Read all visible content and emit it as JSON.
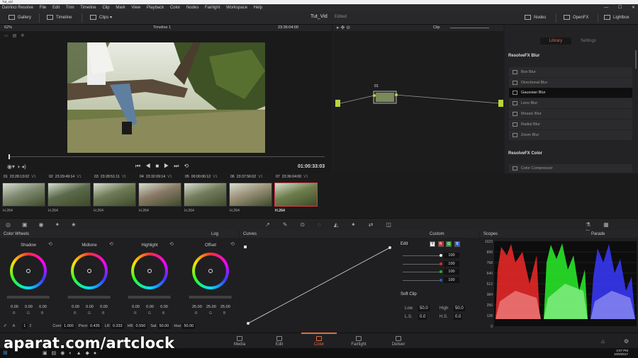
{
  "window": {
    "title": "Tut_vid",
    "app": "DaVinci Resolve",
    "project": "Tut_Vid",
    "status": "Edited"
  },
  "menu": [
    "DaVinci Resolve",
    "File",
    "Edit",
    "Trim",
    "Timeline",
    "Clip",
    "Mark",
    "View",
    "Playback",
    "Color",
    "Nodes",
    "Fairlight",
    "Workspace",
    "Help"
  ],
  "toolbar": {
    "gallery": "Gallery",
    "timeline": "Timeline",
    "clips": "Clips",
    "nodes": "Nodes",
    "openfx": "OpenFX",
    "lightbox": "Lightbox"
  },
  "viewer": {
    "zoom": "62%",
    "timeline_name": "Timeline 1",
    "timecode": "23:36:04:00",
    "duration": "01:00:33:03"
  },
  "nodegraph": {
    "mode": "Clip",
    "node_label": "01"
  },
  "library": {
    "tab_library": "Library",
    "tab_settings": "Settings",
    "section_blur": "ResolveFX Blur",
    "blur_items": [
      "Box Blur",
      "Directional Blur",
      "Gaussian Blur",
      "Lens Blur",
      "Mosaic Blur",
      "Radial Blur",
      "Zoom Blur"
    ],
    "selected": "Gaussian Blur",
    "section_color": "ResolveFX Color",
    "color_items": [
      "Color Compressor"
    ]
  },
  "clips": [
    {
      "num": "01",
      "tc": "23:28:13:02",
      "track": "V1",
      "codec": "H.264"
    },
    {
      "num": "02",
      "tc": "23:29:49:14",
      "track": "V1",
      "codec": "H.264"
    },
    {
      "num": "03",
      "tc": "23:28:51:11",
      "track": "V1",
      "codec": "H.264"
    },
    {
      "num": "04",
      "tc": "23:32:09:14",
      "track": "V1",
      "codec": "H.264"
    },
    {
      "num": "05",
      "tc": "00:00:06:12",
      "track": "V1",
      "codec": "H.264"
    },
    {
      "num": "06",
      "tc": "23:37:56:02",
      "track": "V1",
      "codec": "H.264"
    },
    {
      "num": "07",
      "tc": "23:36:04:00",
      "track": "V1",
      "codec": "H.264"
    }
  ],
  "colorwheels": {
    "title": "Color Wheels",
    "mode": "Log",
    "wheels": [
      {
        "name": "Shadow",
        "vals": [
          "0.00",
          "0.00",
          "0.00"
        ]
      },
      {
        "name": "Midtone",
        "vals": [
          "0.00",
          "0.00",
          "0.00"
        ]
      },
      {
        "name": "Highlight",
        "vals": [
          "0.00",
          "0.00",
          "0.00"
        ]
      },
      {
        "name": "Offset",
        "vals": [
          "25.00",
          "25.00",
          "25.00"
        ]
      }
    ],
    "rgb": [
      "R",
      "G",
      "B"
    ],
    "pages": [
      "1",
      "2"
    ],
    "params": {
      "cont_label": "Cont",
      "cont": "1.000",
      "pivot_label": "Pivot",
      "pivot": "0.435",
      "lr_label": "LR",
      "lr": "0.333",
      "hr_label": "HR",
      "hr": "0.550",
      "sat_label": "Sat",
      "sat": "50.00",
      "hue_label": "Hue",
      "hue": "50.00"
    }
  },
  "curves": {
    "title": "Curves",
    "mode": "Custom",
    "edit_label": "Edit",
    "channels": [
      "Y",
      "R",
      "G",
      "B"
    ],
    "edit_values": [
      "100",
      "100",
      "100",
      "100"
    ],
    "softclip": "Soft Clip",
    "low_label": "Low",
    "low": "50.0",
    "high_label": "High",
    "high": "50.0",
    "ls_label": "L.S.",
    "ls": "0.0",
    "hs_label": "H.S.",
    "hs": "0.0"
  },
  "scopes": {
    "title": "Scopes",
    "mode": "Parade",
    "ticks": [
      "1023",
      "896",
      "768",
      "640",
      "512",
      "384",
      "256",
      "128",
      "0"
    ]
  },
  "pages": [
    "Media",
    "Edit",
    "Color",
    "Fairlight",
    "Deliver"
  ],
  "active_page": "Color",
  "taskbar": {
    "time": "3:07 PM",
    "date": "10/5/2017"
  },
  "watermark": "aparat.com/artclock",
  "colors": {
    "accent": "#e26a40",
    "selected_clip": "#e23b3b",
    "node_green": "#b7d53a"
  }
}
